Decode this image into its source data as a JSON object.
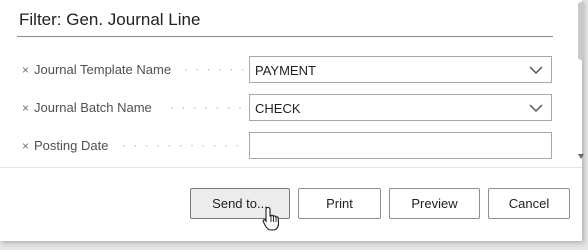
{
  "dialog": {
    "title": "Filter: Gen. Journal Line"
  },
  "filters": [
    {
      "remove": "×",
      "label": "Journal Template Name",
      "dots": "· · · · · · ·",
      "value": "PAYMENT",
      "has_dropdown": true
    },
    {
      "remove": "×",
      "label": "Journal Batch Name",
      "dots": "· · · · · · · · ·",
      "value": "CHECK",
      "has_dropdown": true
    },
    {
      "remove": "×",
      "label": "Posting Date",
      "dots": "· · · · · · · · · · · · · ·",
      "value": "",
      "has_dropdown": false
    }
  ],
  "buttons": {
    "send_to": "Send to...",
    "print": "Print",
    "preview": "Preview",
    "cancel": "Cancel"
  },
  "icons": {
    "dropdown": "chevron-down-icon",
    "remove": "close-icon",
    "cursor": "hand-pointer-icon"
  },
  "colors": {
    "field_border": "#a8a8a8",
    "title_rule": "#8a8a8a",
    "focused_button": "#ececec"
  }
}
